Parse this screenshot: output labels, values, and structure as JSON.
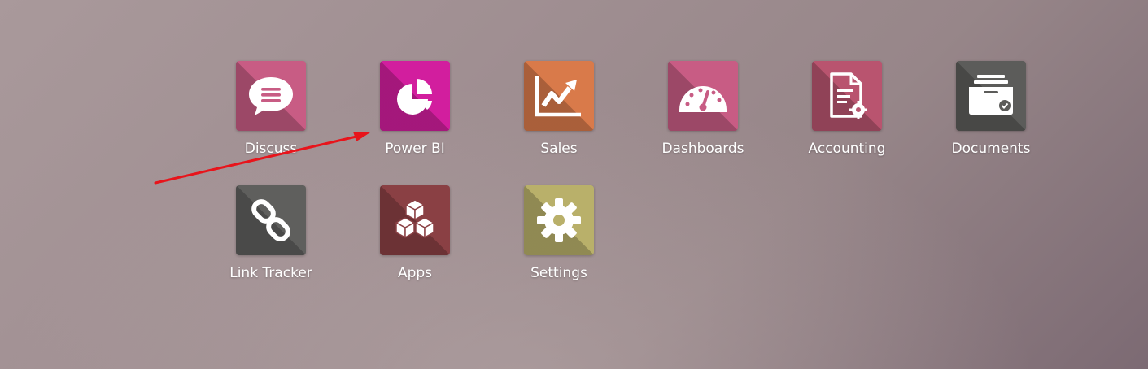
{
  "apps": [
    {
      "label": "Discuss",
      "icon": "chat-bubble-icon",
      "color": "#c85c84"
    },
    {
      "label": "Power BI",
      "icon": "pie-chart-icon",
      "color": "#d21e9e"
    },
    {
      "label": "Sales",
      "icon": "trending-chart-icon",
      "color": "#d97a4a"
    },
    {
      "label": "Dashboards",
      "icon": "gauge-icon",
      "color": "#c85c84"
    },
    {
      "label": "Accounting",
      "icon": "invoice-gear-icon",
      "color": "#b9546f"
    },
    {
      "label": "Documents",
      "icon": "document-tray-icon",
      "color": "#5c5c5a"
    },
    {
      "label": "Link Tracker",
      "icon": "chain-link-icon",
      "color": "#5f5f5d"
    },
    {
      "label": "Apps",
      "icon": "cubes-icon",
      "color": "#8a4044"
    },
    {
      "label": "Settings",
      "icon": "gear-icon",
      "color": "#b9b06a"
    }
  ],
  "annotation": {
    "color": "#e8141b",
    "icon": "red-arrow"
  }
}
